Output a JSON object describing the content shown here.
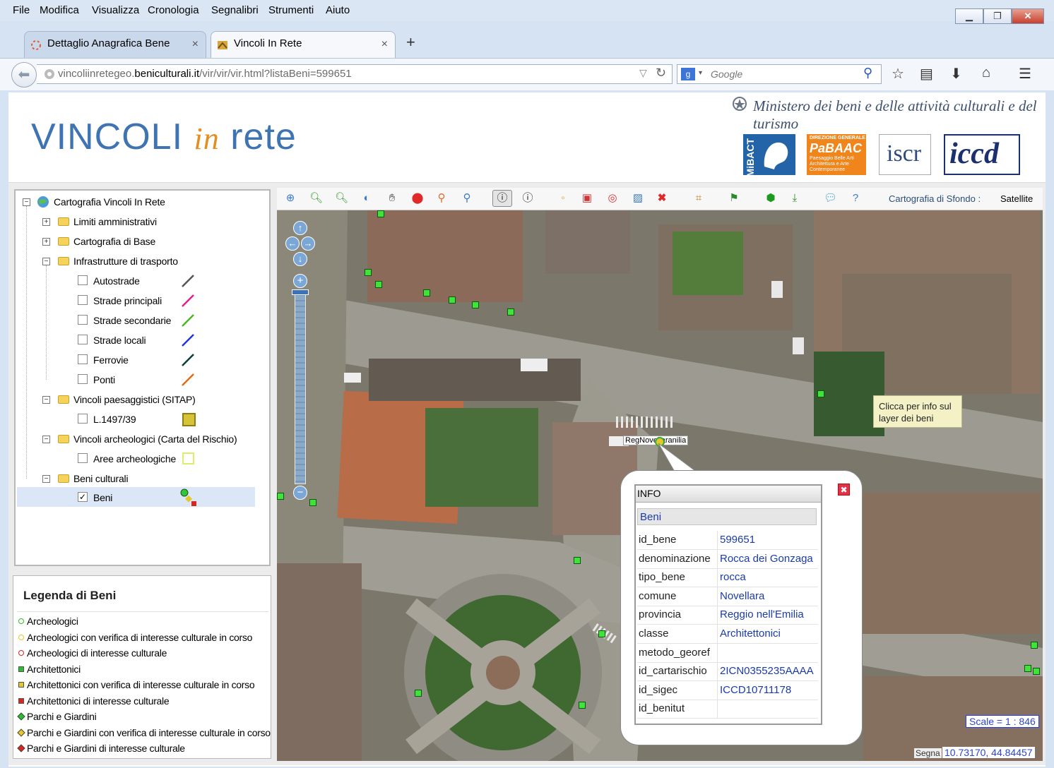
{
  "browser": {
    "menu": [
      "File",
      "Modifica",
      "Visualizza",
      "Cronologia",
      "Segnalibri",
      "Strumenti",
      "Aiuto"
    ],
    "tabs": [
      {
        "label": "Dettaglio Anagrafica Bene",
        "close": "×"
      },
      {
        "label": "Vincoli In Rete",
        "close": "×"
      }
    ],
    "newtab": "+",
    "url_prefix": "vincoliinretegeo.",
    "url_domain": "beniculturali.it",
    "url_path": "/vir/vir/vir.html?listaBeni=599651",
    "search_placeholder": "Google"
  },
  "header": {
    "logo_vincoli": "VINCOLI",
    "logo_in": "in",
    "logo_rete": "rete",
    "ministry": "Ministero dei beni e delle attività culturali e del turismo",
    "logos": [
      "MiBACT",
      "PaBAAC",
      "iscr",
      "iccd"
    ],
    "pabaac_small": "DIREZIONE GENERALE",
    "pabaac_sub": "Paesaggio Belle Arti Architettura e Arte Contemporanee"
  },
  "tree": {
    "root": "Cartografia Vincoli In Rete",
    "nodes": {
      "limiti": "Limiti amministrativi",
      "base": "Cartografia di Base",
      "infra": "Infrastrutture di trasporto",
      "autostrade": "Autostrade",
      "principali": "Strade principali",
      "secondarie": "Strade secondarie",
      "locali": "Strade locali",
      "ferrovie": "Ferrovie",
      "ponti": "Ponti",
      "paes": "Vincoli paesaggistici (SITAP)",
      "l1497": "L.1497/39",
      "arch": "Vincoli archeologici (Carta del Rischio)",
      "aree": "Aree archeologiche",
      "beniculturali": "Beni culturali",
      "beni": "Beni"
    },
    "line_colors": {
      "autostrade": "#555555",
      "principali": "#e0208a",
      "secondarie": "#47b81f",
      "locali": "#2233e8",
      "ferrovie": "#0d3e3a",
      "ponti": "#e36a12"
    }
  },
  "legend": {
    "title": "Legenda di Beni",
    "items": [
      {
        "label": "Archeologici",
        "color": "#2bbf2b",
        "shape": "circle"
      },
      {
        "label": "Archeologici con verifica di interesse culturale in corso",
        "color": "#e5c92a",
        "shape": "circle"
      },
      {
        "label": "Archeologici di interesse culturale",
        "color": "#d9271f",
        "shape": "circle"
      },
      {
        "label": "Architettonici",
        "color": "#2bbf2b",
        "shape": "square"
      },
      {
        "label": "Architettonici con verifica di interesse culturale in corso",
        "color": "#e5c92a",
        "shape": "square"
      },
      {
        "label": "Architettonici di interesse culturale",
        "color": "#d9271f",
        "shape": "square"
      },
      {
        "label": "Parchi e Giardini",
        "color": "#2bbf2b",
        "shape": "diamond"
      },
      {
        "label": "Parchi e Giardini con verifica di interesse culturale in corso",
        "color": "#e5c92a",
        "shape": "diamond"
      },
      {
        "label": "Parchi e Giardini di interesse culturale",
        "color": "#d9271f",
        "shape": "diamond"
      }
    ]
  },
  "toolbar": {
    "background_label": "Cartografia di Sfondo :",
    "background_value": "Satellite"
  },
  "map": {
    "tooltip": "Clicca per info sul layer dei beni",
    "scale": "Scale = 1 : 846",
    "coords": "10.73170, 44.84457",
    "segna": "Segna",
    "label": "RegNovellaranilia"
  },
  "info": {
    "header": "INFO",
    "layer": "Beni",
    "rows": [
      {
        "k": "id_bene",
        "v": "599651"
      },
      {
        "k": "denominazione",
        "v": "Rocca dei Gonzaga"
      },
      {
        "k": "tipo_bene",
        "v": "rocca"
      },
      {
        "k": "comune",
        "v": "Novellara"
      },
      {
        "k": "provincia",
        "v": "Reggio nell'Emilia"
      },
      {
        "k": "classe",
        "v": "Architettonici"
      },
      {
        "k": "metodo_georef",
        "v": ""
      },
      {
        "k": "id_cartarischio",
        "v": "2ICN0355235AAAA"
      },
      {
        "k": "id_sigec",
        "v": "ICCD10711178"
      },
      {
        "k": "id_benitut",
        "v": ""
      }
    ]
  }
}
